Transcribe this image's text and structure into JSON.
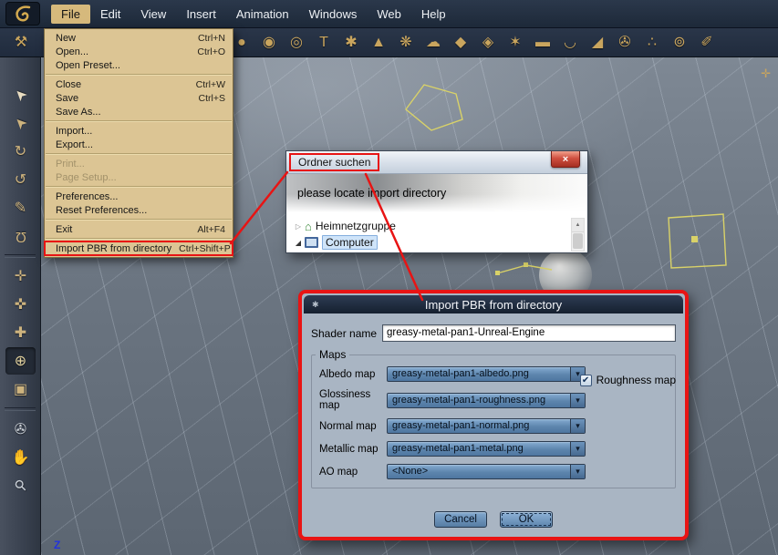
{
  "app": {
    "menubar_items": [
      "File",
      "Edit",
      "View",
      "Insert",
      "Animation",
      "Windows",
      "Web",
      "Help"
    ]
  },
  "file_menu": {
    "items": [
      {
        "label": "New",
        "shortcut": "Ctrl+N"
      },
      {
        "label": "Open...",
        "shortcut": "Ctrl+O"
      },
      {
        "label": "Open Preset...",
        "shortcut": ""
      },
      {
        "label": "Close",
        "shortcut": "Ctrl+W"
      },
      {
        "label": "Save",
        "shortcut": "Ctrl+S"
      },
      {
        "label": "Save As...",
        "shortcut": ""
      },
      {
        "label": "Import...",
        "shortcut": ""
      },
      {
        "label": "Export...",
        "shortcut": ""
      },
      {
        "label": "Print...",
        "shortcut": ""
      },
      {
        "label": "Page Setup...",
        "shortcut": ""
      },
      {
        "label": "Preferences...",
        "shortcut": ""
      },
      {
        "label": "Reset Preferences...",
        "shortcut": ""
      },
      {
        "label": "Exit",
        "shortcut": "Alt+F4"
      },
      {
        "label": "Import PBR from directory",
        "shortcut": "Ctrl+Shift+P"
      }
    ]
  },
  "toolbar": {
    "icons": [
      {
        "name": "hammer-tool-icon",
        "glyph": "⚒"
      },
      {
        "name": "ball-primitive-icon",
        "glyph": "●"
      },
      {
        "name": "spiral-primitive-icon",
        "glyph": "◉"
      },
      {
        "name": "torus-primitive-icon",
        "glyph": "◎"
      },
      {
        "name": "text-primitive-icon",
        "glyph": "T"
      },
      {
        "name": "particle-primitive-icon",
        "glyph": "✱"
      },
      {
        "name": "cone-primitive-icon",
        "glyph": "▲"
      },
      {
        "name": "flower-primitive-icon",
        "glyph": "❋"
      },
      {
        "name": "cloud-primitive-icon",
        "glyph": "☁"
      },
      {
        "name": "drop-primitive-icon",
        "glyph": "◆"
      },
      {
        "name": "gem-primitive-icon",
        "glyph": "◈"
      },
      {
        "name": "star-primitive-icon",
        "glyph": "✶"
      },
      {
        "name": "capsule-primitive-icon",
        "glyph": "▬"
      },
      {
        "name": "bowl-primitive-icon",
        "glyph": "◡"
      },
      {
        "name": "wedge-primitive-icon",
        "glyph": "◢"
      },
      {
        "name": "camera-object-icon",
        "glyph": "✇"
      },
      {
        "name": "scatter-object-icon",
        "glyph": "∴"
      },
      {
        "name": "ring-object-icon",
        "glyph": "⊚"
      },
      {
        "name": "spline-pen-icon",
        "glyph": "✐"
      }
    ]
  },
  "sidebar": {
    "tools": [
      {
        "name": "select-tool-icon",
        "glyph": "➤"
      },
      {
        "name": "move-tool-icon",
        "glyph": "➤"
      },
      {
        "name": "rotate-tool-icon",
        "glyph": "↻"
      },
      {
        "name": "scale-tool-icon",
        "glyph": "↺"
      },
      {
        "name": "knife-tool-icon",
        "glyph": "✎"
      },
      {
        "name": "magnet-tool-icon",
        "glyph": "Ω"
      },
      {
        "name": "translate-gizmo-icon",
        "glyph": "✛"
      },
      {
        "name": "scale-gizmo-icon",
        "glyph": "✜"
      },
      {
        "name": "axis-gizmo-icon",
        "glyph": "✚"
      },
      {
        "name": "sphere-gizmo-icon",
        "glyph": "⊕"
      },
      {
        "name": "box-mode-icon",
        "glyph": "▣"
      },
      {
        "name": "camera-orbit-icon",
        "glyph": "✇"
      },
      {
        "name": "pan-hand-icon",
        "glyph": "✋"
      },
      {
        "name": "zoom-icon",
        "glyph": "⚲"
      }
    ]
  },
  "viewport": {
    "z_axis_label": "Z",
    "axis_widget_glyph": "✛"
  },
  "folder_dialog": {
    "title": "Ordner suchen",
    "close_glyph": "×",
    "message": "please locate import directory",
    "tree": [
      {
        "label": "Heimnetzgruppe",
        "expander": "▷"
      },
      {
        "label": "Computer",
        "expander": "◢"
      }
    ],
    "scroll_up_glyph": "▲"
  },
  "pbr_dialog": {
    "title": "Import PBR from directory",
    "title_icon_glyph": "✱",
    "shader_name_label": "Shader name",
    "shader_name_value": "greasy-metal-pan1-Unreal-Engine",
    "group_label": "Maps",
    "dropdown_arrow_glyph": "▾",
    "fields": [
      {
        "label": "Albedo map",
        "value": "greasy-metal-pan1-albedo.png"
      },
      {
        "label": "Glossiness map",
        "value": "greasy-metal-pan1-roughness.png"
      },
      {
        "label": "Normal map",
        "value": "greasy-metal-pan1-normal.png"
      },
      {
        "label": "Metallic map",
        "value": "greasy-metal-pan1-metal.png"
      },
      {
        "label": "AO map",
        "value": "<None>"
      }
    ],
    "roughness_checkbox_label": "Roughness map",
    "checkbox_glyph": "✔",
    "cancel_label": "Cancel",
    "ok_label": "OK"
  },
  "colors": {
    "annotation_red": "#e81414",
    "icon_gold": "#c9a55e",
    "dialog_body": "#a9b5c3",
    "dropdown_blue": "#5d85ad"
  }
}
